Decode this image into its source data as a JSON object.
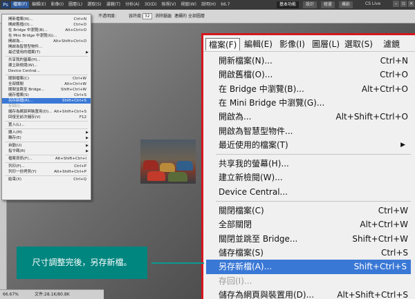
{
  "app": {
    "logo": "Ps",
    "menubar": [
      "檔案(F)",
      "編輯(E)",
      "影像(I)",
      "圖層(L)",
      "選取(S)",
      "濾鏡(T)",
      "分析(A)",
      "3D(D)",
      "檢視(V)",
      "視窗(W)",
      "說明(H)"
    ],
    "zoom_level": "66.7",
    "workspace_buttons": [
      "基本功能",
      "設計",
      "繪畫",
      "攝影"
    ],
    "cs_live": "CS Live",
    "window_controls": [
      "–",
      "▫",
      "×"
    ],
    "options": {
      "sample_label": "不透明度:",
      "tolerance_label": "容許度:",
      "tolerance_value": "32",
      "antialias": "消除鋸齒",
      "contiguous": "連續的",
      "all_layers": "全部圖層"
    },
    "status": {
      "zoom": "66.67%",
      "doc": "文件:28.1K/80.8K"
    }
  },
  "small_menu": {
    "items": [
      {
        "label": "開新檔案(N)...",
        "shortcut": "Ctrl+N"
      },
      {
        "label": "開啟舊檔(O)...",
        "shortcut": "Ctrl+O"
      },
      {
        "label": "在 Bridge 中瀏覽(B)...",
        "shortcut": "Alt+Ctrl+O"
      },
      {
        "label": "在 Mini Bridge 中瀏覽(G)...",
        "shortcut": ""
      },
      {
        "label": "開啟為...",
        "shortcut": "Alt+Shift+Ctrl+O"
      },
      {
        "label": "開啟為智慧型物件...",
        "shortcut": ""
      },
      {
        "label": "最近使用的檔案(T)",
        "shortcut": "",
        "submenu": true
      },
      {
        "sep": true
      },
      {
        "label": "共享我的螢幕(H)...",
        "shortcut": ""
      },
      {
        "label": "建立新檢閱(W)...",
        "shortcut": ""
      },
      {
        "label": "Device Central...",
        "shortcut": ""
      },
      {
        "sep": true
      },
      {
        "label": "關閉檔案(C)",
        "shortcut": "Ctrl+W"
      },
      {
        "label": "全部關閉",
        "shortcut": "Alt+Ctrl+W"
      },
      {
        "label": "關閉並跳至 Bridge...",
        "shortcut": "Shift+Ctrl+W"
      },
      {
        "label": "儲存檔案(S)",
        "shortcut": "Ctrl+S"
      },
      {
        "label": "另存新檔(A)...",
        "shortcut": "Shift+Ctrl+S",
        "highlighted": true
      },
      {
        "label": "存回(I)...",
        "shortcut": "",
        "disabled": true
      },
      {
        "label": "儲存為網頁與裝置用(D)...",
        "shortcut": "Alt+Shift+Ctrl+S"
      },
      {
        "label": "回復至前次儲存(V)",
        "shortcut": "F12"
      },
      {
        "sep": true
      },
      {
        "label": "置入(L)...",
        "shortcut": ""
      },
      {
        "sep": true
      },
      {
        "label": "讀入(M)",
        "shortcut": "",
        "submenu": true
      },
      {
        "label": "轉存(E)",
        "shortcut": "",
        "submenu": true
      },
      {
        "sep": true
      },
      {
        "label": "自動(U)",
        "shortcut": "",
        "submenu": true
      },
      {
        "label": "指令碼(R)",
        "shortcut": "",
        "submenu": true
      },
      {
        "sep": true
      },
      {
        "label": "檔案資訊(F)...",
        "shortcut": "Alt+Shift+Ctrl+I"
      },
      {
        "sep": true
      },
      {
        "label": "列印(P)...",
        "shortcut": "Ctrl+P"
      },
      {
        "label": "列印一份拷貝(Y)",
        "shortcut": "Alt+Shift+Ctrl+P"
      },
      {
        "sep": true
      },
      {
        "label": "結束(X)",
        "shortcut": "Ctrl+Q"
      }
    ]
  },
  "zoom_panel": {
    "menubar": [
      "檔案(F)",
      "編輯(E)",
      "影像(I)",
      "圖層(L)",
      "選取(S)",
      "濾鏡"
    ],
    "items": [
      {
        "label": "開新檔案(N)...",
        "shortcut": "Ctrl+N"
      },
      {
        "label": "開啟舊檔(O)...",
        "shortcut": "Ctrl+O"
      },
      {
        "label": "在 Bridge 中瀏覽(B)...",
        "shortcut": "Alt+Ctrl+O"
      },
      {
        "label": "在 Mini Bridge 中瀏覽(G)...",
        "shortcut": ""
      },
      {
        "label": "開啟為...",
        "shortcut": "Alt+Shift+Ctrl+O"
      },
      {
        "label": "開啟為智慧型物件...",
        "shortcut": ""
      },
      {
        "label": "最近使用的檔案(T)",
        "shortcut": "",
        "submenu": true
      },
      {
        "sep": true
      },
      {
        "label": "共享我的螢幕(H)...",
        "shortcut": ""
      },
      {
        "label": "建立新檢閱(W)...",
        "shortcut": ""
      },
      {
        "label": "Device Central...",
        "shortcut": ""
      },
      {
        "sep": true
      },
      {
        "label": "關閉檔案(C)",
        "shortcut": "Ctrl+W"
      },
      {
        "label": "全部關閉",
        "shortcut": "Alt+Ctrl+W"
      },
      {
        "label": "關閉並跳至 Bridge...",
        "shortcut": "Shift+Ctrl+W"
      },
      {
        "label": "儲存檔案(S)",
        "shortcut": "Ctrl+S"
      },
      {
        "label": "另存新檔(A)...",
        "shortcut": "Shift+Ctrl+S",
        "highlighted": true
      },
      {
        "label": "存回(I)...",
        "shortcut": "",
        "disabled": true
      },
      {
        "label": "儲存為網頁與裝置用(D)...",
        "shortcut": "Alt+Shift+Ctrl+S"
      }
    ]
  },
  "callout": {
    "text": "尺寸調整完後，另存新檔。"
  },
  "colors": {
    "highlight": "#3a78d6",
    "zoom_border": "#d6161d",
    "callout_bg": "#00857f"
  }
}
